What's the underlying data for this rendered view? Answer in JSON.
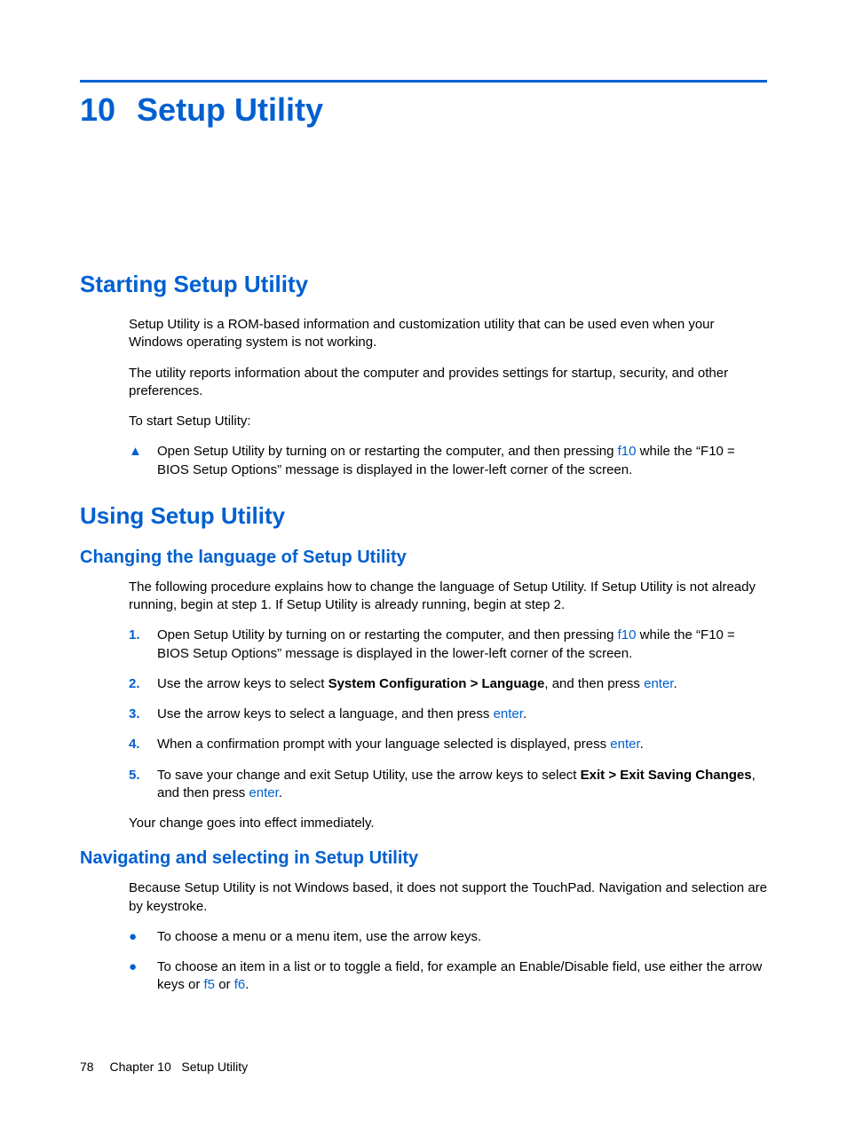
{
  "chapter": {
    "number": "10",
    "title": "Setup Utility"
  },
  "section1": {
    "heading": "Starting Setup Utility",
    "p1": "Setup Utility is a ROM-based information and customization utility that can be used even when your Windows operating system is not working.",
    "p2": "The utility reports information about the computer and provides settings for startup, security, and other preferences.",
    "p3": "To start Setup Utility:",
    "bullet": {
      "pre": "Open Setup Utility by turning on or restarting the computer, and then pressing ",
      "key": "f10",
      "post": " while the “F10 = BIOS Setup Options” message is displayed in the lower-left corner of the screen."
    }
  },
  "section2": {
    "heading": "Using Setup Utility"
  },
  "sub1": {
    "heading": "Changing the language of Setup Utility",
    "intro": "The following procedure explains how to change the language of Setup Utility. If Setup Utility is not already running, begin at step 1. If Setup Utility is already running, begin at step 2.",
    "step1": {
      "num": "1.",
      "pre": "Open Setup Utility by turning on or restarting the computer, and then pressing ",
      "key": "f10",
      "post": " while the “F10 = BIOS Setup Options” message is displayed in the lower-left corner of the screen."
    },
    "step2": {
      "num": "2.",
      "pre": "Use the arrow keys to select ",
      "bold": "System Configuration > Language",
      "mid": ", and then press ",
      "key": "enter",
      "post": "."
    },
    "step3": {
      "num": "3.",
      "pre": "Use the arrow keys to select a language, and then press ",
      "key": "enter",
      "post": "."
    },
    "step4": {
      "num": "4.",
      "pre": "When a confirmation prompt with your language selected is displayed, press ",
      "key": "enter",
      "post": "."
    },
    "step5": {
      "num": "5.",
      "pre": "To save your change and exit Setup Utility, use the arrow keys to select ",
      "bold": "Exit > Exit Saving Changes",
      "mid": ", and then press ",
      "key": "enter",
      "post": "."
    },
    "outro": "Your change goes into effect immediately."
  },
  "sub2": {
    "heading": "Navigating and selecting in Setup Utility",
    "intro": "Because Setup Utility is not Windows based, it does not support the TouchPad. Navigation and selection are by keystroke.",
    "bullet1": "To choose a menu or a menu item, use the arrow keys.",
    "bullet2": {
      "pre": "To choose an item in a list or to toggle a field, for example an Enable/Disable field, use either the arrow keys or ",
      "key1": "f5",
      "mid": " or ",
      "key2": "f6",
      "post": "."
    }
  },
  "footer": {
    "page": "78",
    "chapter_label": "Chapter 10",
    "title": "Setup Utility"
  }
}
